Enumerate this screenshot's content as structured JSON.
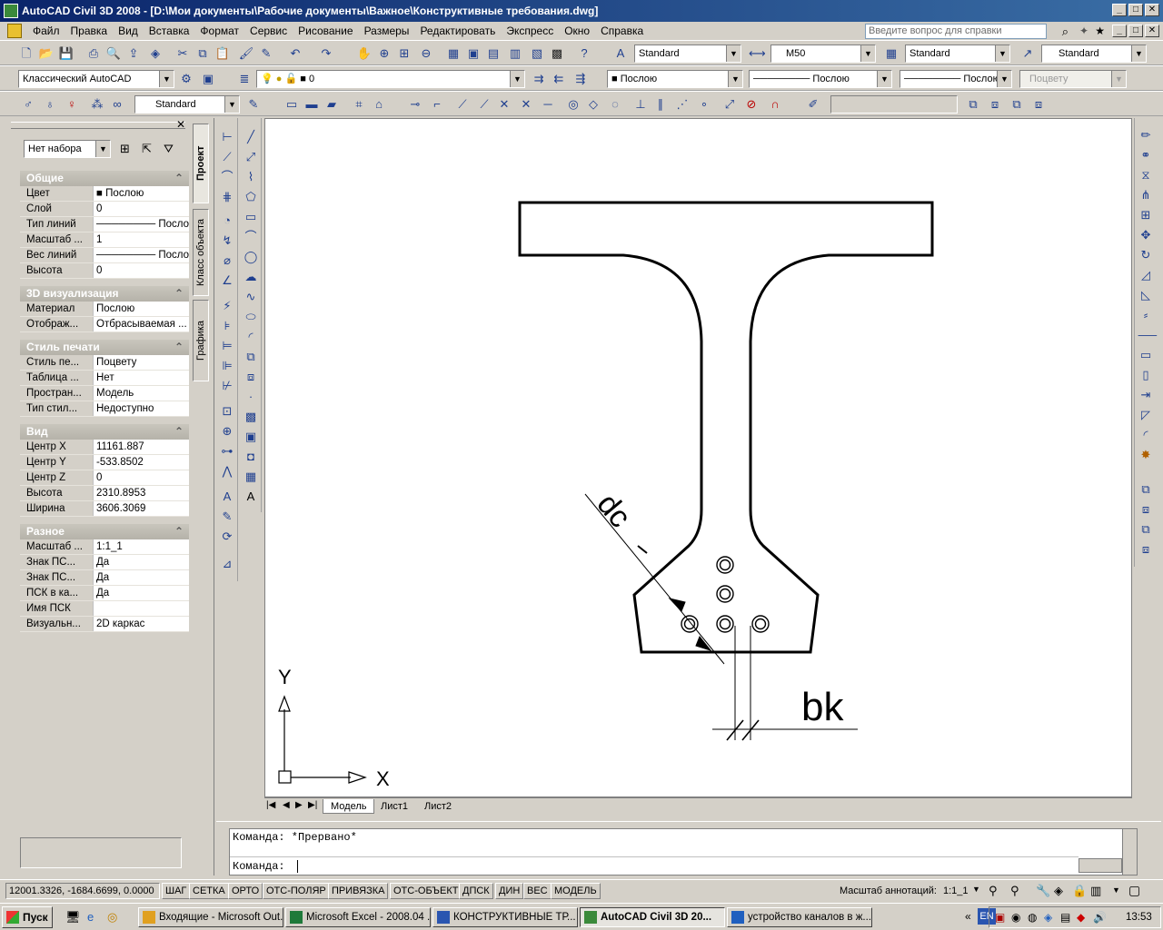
{
  "window": {
    "title": "AutoCAD Civil 3D 2008 - [D:\\Мои документы\\Рабочие документы\\Важное\\Конструктивные требования.dwg]",
    "controls": [
      "_",
      "□",
      "✕"
    ]
  },
  "menu": {
    "items": [
      "Файл",
      "Правка",
      "Вид",
      "Вставка",
      "Формат",
      "Сервис",
      "Рисование",
      "Размеры",
      "Редактировать",
      "Экспресс",
      "Окно",
      "Справка"
    ],
    "help_placeholder": "Введите вопрос для справки"
  },
  "toolbar1": {
    "text_style": "Standard",
    "dim_style": "M50",
    "table_style": "Standard",
    "mleader_style": "Standard"
  },
  "toolbar2": {
    "workspace": "Классический AutoCAD",
    "layer": "0",
    "color": "Послою",
    "linetype": "Послою",
    "lineweight": "Послою",
    "plotstyle": "Поцвету"
  },
  "toolbar3": {
    "visual_style": "Standard"
  },
  "properties": {
    "selection": "Нет набора",
    "sections": [
      {
        "title": "Общие",
        "rows": [
          {
            "key": "Цвет",
            "value": "Послою"
          },
          {
            "key": "Слой",
            "value": "0"
          },
          {
            "key": "Тип линий",
            "value": "Послою"
          },
          {
            "key": "Масштаб ...",
            "value": "1"
          },
          {
            "key": "Вес линий",
            "value": "Послою"
          },
          {
            "key": "Высота",
            "value": "0"
          }
        ]
      },
      {
        "title": "3D визуализация",
        "rows": [
          {
            "key": "Материал",
            "value": "Послою"
          },
          {
            "key": "Отображ...",
            "value": "Отбрасываемая ..."
          }
        ]
      },
      {
        "title": "Стиль печати",
        "rows": [
          {
            "key": "Стиль пе...",
            "value": "Поцвету"
          },
          {
            "key": "Таблица ...",
            "value": "Нет"
          },
          {
            "key": "Простран...",
            "value": "Модель"
          },
          {
            "key": "Тип стил...",
            "value": "Недоступно"
          }
        ]
      },
      {
        "title": "Вид",
        "rows": [
          {
            "key": "Центр X",
            "value": "11161.887"
          },
          {
            "key": "Центр Y",
            "value": "-533.8502"
          },
          {
            "key": "Центр Z",
            "value": "0"
          },
          {
            "key": "Высота",
            "value": "2310.8953"
          },
          {
            "key": "Ширина",
            "value": "3606.3069"
          }
        ]
      },
      {
        "title": "Разное",
        "rows": [
          {
            "key": "Масштаб ...",
            "value": "1:1_1"
          },
          {
            "key": "Знак ПС...",
            "value": "Да"
          },
          {
            "key": "Знак ПС...",
            "value": "Да"
          },
          {
            "key": "ПСК в ка...",
            "value": "Да"
          },
          {
            "key": "Имя ПСК",
            "value": ""
          },
          {
            "key": "Визуальн...",
            "value": "2D каркас"
          }
        ]
      }
    ],
    "side_tabs": [
      "Проект",
      "Класс объекта",
      "Графика"
    ]
  },
  "drawing": {
    "label_dc": "dc",
    "label_bk": "bk",
    "ucs_x": "X",
    "ucs_y": "Y"
  },
  "layout_tabs": [
    "Модель",
    "Лист1",
    "Лист2"
  ],
  "command": {
    "history": "Команда:  *Прервано*",
    "prompt": "Команда:"
  },
  "status": {
    "coords": "12001.3326, -1684.6699, 0.0000",
    "toggles": [
      "ШАГ",
      "СЕТКА",
      "ОРТО",
      "ОТС-ПОЛЯР",
      "ПРИВЯЗКА",
      "ОТС-ОБЪЕКТ",
      "ДПСК",
      "ДИН",
      "ВЕС",
      "МОДЕЛЬ"
    ],
    "annotation_label": "Масштаб аннотаций:",
    "annotation_value": "1:1_1"
  },
  "taskbar": {
    "start": "Пуск",
    "tasks": [
      {
        "label": "Входящие - Microsoft Out...",
        "active": false
      },
      {
        "label": "Microsoft Excel - 2008.04 ...",
        "active": false
      },
      {
        "label": "КОНСТРУКТИВНЫЕ ТР...",
        "active": false
      },
      {
        "label": "AutoCAD Civil 3D 20...",
        "active": true
      },
      {
        "label": "устройство каналов в ж...",
        "active": false
      }
    ],
    "lang": "EN",
    "clock": "13:53"
  }
}
